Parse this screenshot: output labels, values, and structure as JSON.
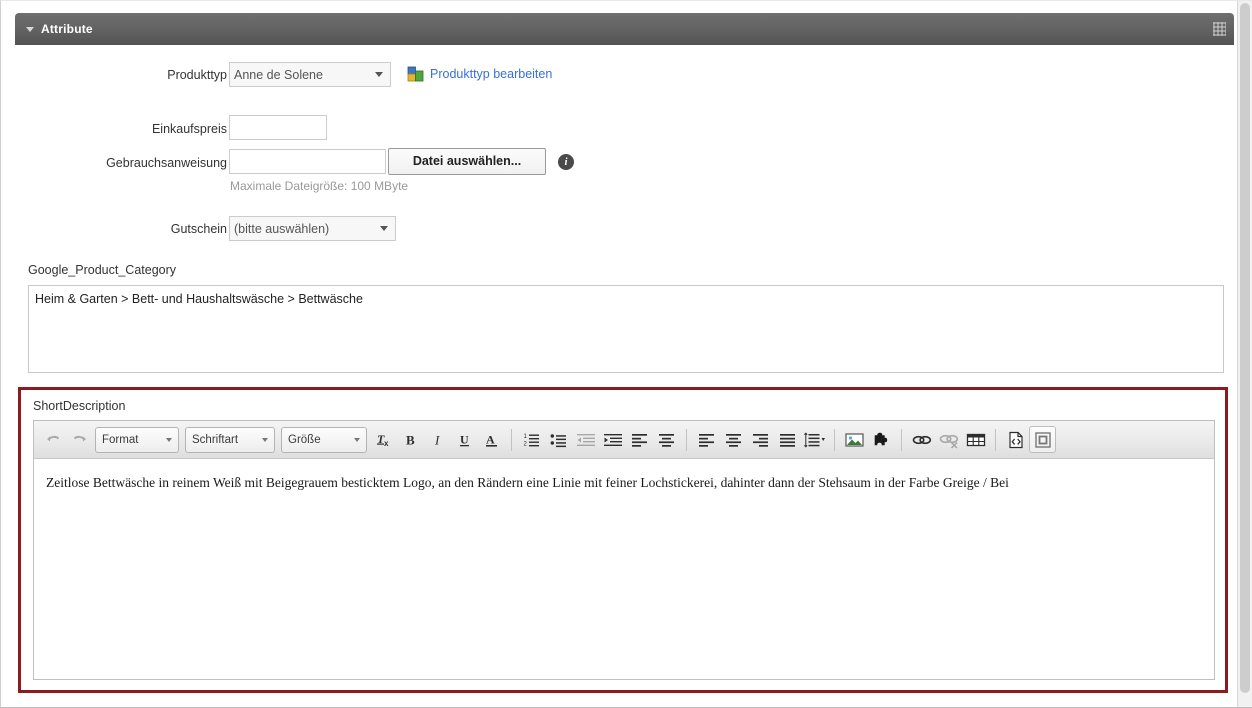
{
  "panel": {
    "title": "Attribute",
    "collapse_icon": "chevron-down-icon",
    "grip_icon": "resize-grip-icon"
  },
  "form": {
    "produkttyp": {
      "label": "Produkttyp",
      "value": "Anne de Solene",
      "edit_link": "Produkttyp bearbeiten",
      "edit_icon": "cubes-icon",
      "dropdown_icon": "chevron-down-icon"
    },
    "einkaufspreis": {
      "label": "Einkaufspreis",
      "value": "",
      "placeholder": ""
    },
    "gebrauchsanweisung": {
      "label": "Gebrauchsanweisung",
      "value": "",
      "placeholder": "",
      "file_button": "Datei auswählen...",
      "info_icon": "info-icon",
      "info_glyph": "i",
      "hint": "Maximale Dateigröße: 100 MByte"
    },
    "gutschein": {
      "label": "Gutschein",
      "value": "(bitte auswählen)",
      "dropdown_icon": "chevron-down-icon"
    }
  },
  "google_product_category": {
    "label": "Google_Product_Category",
    "value": "Heim & Garten > Bett- und Haushaltswäsche > Bettwäsche"
  },
  "short_description": {
    "label": "ShortDescription",
    "highlight_color": "#8d1a1c",
    "body_text": "Zeitlose Bettwäsche in reinem Weiß mit Beigegrauem besticktem Logo, an den Rändern eine Linie mit feiner Lochstickerei, dahinter dann der Stehsaum in der Farbe Greige / Bei",
    "toolbar": {
      "undo": {
        "name": "undo-icon",
        "glyph": "↰",
        "disabled": true
      },
      "redo": {
        "name": "redo-icon",
        "glyph": "↱",
        "disabled": true
      },
      "format_combo": "Format",
      "font_combo": "Schriftart",
      "size_combo": "Größe",
      "buttons": [
        {
          "name": "remove-format-icon",
          "label": "Tx"
        },
        {
          "name": "bold-icon",
          "label": "B"
        },
        {
          "name": "italic-icon",
          "label": "I"
        },
        {
          "name": "underline-icon",
          "label": "U"
        },
        {
          "name": "text-color-icon",
          "label": "A"
        },
        {
          "name": "numbered-list-icon",
          "label": "1."
        },
        {
          "name": "bulleted-list-icon",
          "label": "•"
        },
        {
          "name": "decrease-indent-icon",
          "label": "",
          "disabled": true
        },
        {
          "name": "increase-indent-icon",
          "label": ""
        },
        {
          "name": "align-left-icon",
          "label": ""
        },
        {
          "name": "align-center-icon",
          "label": ""
        },
        {
          "name": "align-left-2-icon",
          "label": ""
        },
        {
          "name": "align-center-2-icon",
          "label": ""
        },
        {
          "name": "align-right-icon",
          "label": ""
        },
        {
          "name": "align-justify-icon",
          "label": ""
        },
        {
          "name": "line-height-icon",
          "label": ""
        },
        {
          "name": "insert-image-icon",
          "label": ""
        },
        {
          "name": "insert-template-icon",
          "label": ""
        },
        {
          "name": "insert-link-icon",
          "label": ""
        },
        {
          "name": "unlink-icon",
          "label": "",
          "disabled": true
        },
        {
          "name": "insert-table-icon",
          "label": ""
        },
        {
          "name": "source-code-icon",
          "label": ""
        },
        {
          "name": "show-blocks-icon",
          "label": "",
          "active": true
        }
      ]
    }
  },
  "scrollbar": {
    "name": "vertical-scrollbar"
  }
}
